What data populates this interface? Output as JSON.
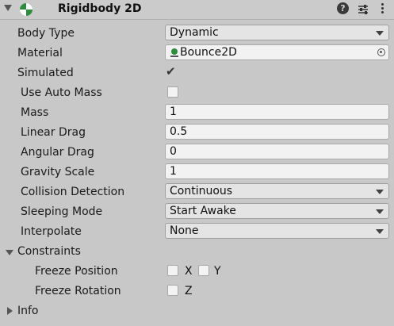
{
  "component": {
    "title": "Rigidbody 2D",
    "help_icon": "?"
  },
  "fields": {
    "body_type": {
      "label": "Body Type",
      "value": "Dynamic"
    },
    "material": {
      "label": "Material",
      "value": "Bounce2D"
    },
    "simulated": {
      "label": "Simulated",
      "checked": true,
      "check_glyph": "✔"
    },
    "use_auto_mass": {
      "label": "Use Auto Mass",
      "checked": false
    },
    "mass": {
      "label": "Mass",
      "value": "1"
    },
    "linear_drag": {
      "label": "Linear Drag",
      "value": "0.5"
    },
    "angular_drag": {
      "label": "Angular Drag",
      "value": "0"
    },
    "gravity_scale": {
      "label": "Gravity Scale",
      "value": "1"
    },
    "collision_detection": {
      "label": "Collision Detection",
      "value": "Continuous"
    },
    "sleeping_mode": {
      "label": "Sleeping Mode",
      "value": "Start Awake"
    },
    "interpolate": {
      "label": "Interpolate",
      "value": "None"
    }
  },
  "constraints": {
    "label": "Constraints",
    "freeze_position": {
      "label": "Freeze Position",
      "x_label": "X",
      "y_label": "Y",
      "x_checked": false,
      "y_checked": false
    },
    "freeze_rotation": {
      "label": "Freeze Rotation",
      "z_label": "Z",
      "z_checked": false
    }
  },
  "info": {
    "label": "Info"
  },
  "colors": {
    "background": "#c8c8c8",
    "field_bg": "#f2f2f2",
    "dropdown_bg": "#e4e4e4",
    "icon_green": "#2e8b3d"
  }
}
